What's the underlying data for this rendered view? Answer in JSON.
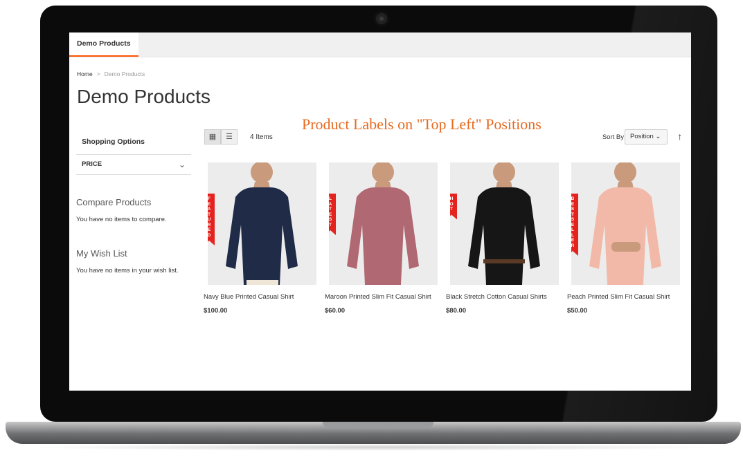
{
  "tab": {
    "label": "Demo Products"
  },
  "breadcrumb": {
    "home": "Home",
    "separator": ">",
    "current": "Demo Products"
  },
  "page": {
    "title": "Demo Products"
  },
  "promo": {
    "text": "Product Labels on \"Top Left\" Positions"
  },
  "sidebar": {
    "shopping_options": "Shopping Options",
    "filter_price": "PRICE",
    "compare_title": "Compare Products",
    "compare_text": "You have no items to compare.",
    "wishlist_title": "My Wish List",
    "wishlist_text": "You have no items in your wish list."
  },
  "toolbar": {
    "count": "4 Items",
    "sort_label": "Sort By",
    "sort_value": "Position"
  },
  "products": [
    {
      "name": "Navy Blue Printed Casual Shirt",
      "price": "$100.00",
      "label": "FEATURED",
      "shirt_color": "#1f2b47",
      "label_color": "#e4231f"
    },
    {
      "name": "Maroon Printed Slim Fit Casual Shirt",
      "price": "$60.00",
      "label": "LATEST",
      "shirt_color": "#b06872",
      "label_color": "#e4231f"
    },
    {
      "name": "Black Stretch Cotton Casual Shirts",
      "price": "$80.00",
      "label": "HOT",
      "shirt_color": "#161616",
      "label_color": "#e4231f"
    },
    {
      "name": "Peach Printed Slim Fit Casual Shirt",
      "price": "$50.00",
      "label": "BEST SELLER",
      "shirt_color": "#f2b9a9",
      "label_color": "#e4231f"
    }
  ],
  "colors": {
    "accent": "#ff5501",
    "promo": "#e66a1f",
    "label": "#e4231f"
  }
}
